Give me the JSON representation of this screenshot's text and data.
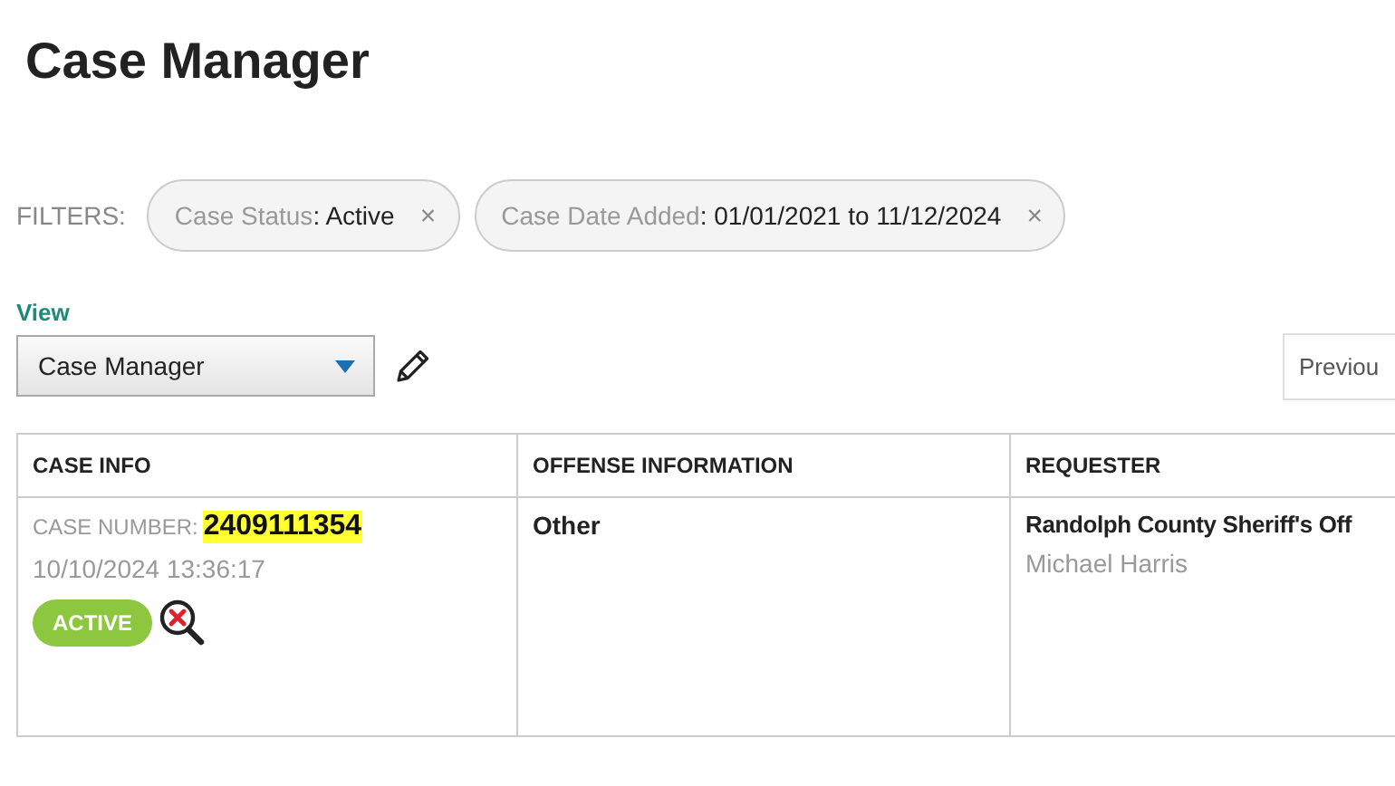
{
  "page_title": "Case Manager",
  "filters": {
    "label": "FILTERS:",
    "chips": [
      {
        "name": "Case Status",
        "value": ": Active",
        "remove": "×"
      },
      {
        "name": "Case Date Added",
        "value": ": 01/01/2021 to 11/12/2024",
        "remove": "×"
      }
    ]
  },
  "view": {
    "label": "View",
    "value": "Case Manager"
  },
  "pagination": {
    "previous": "Previou"
  },
  "table": {
    "columns": [
      "CASE INFO",
      "OFFENSE INFORMATION",
      "REQUESTER"
    ],
    "rows": [
      {
        "case_number_label": "CASE NUMBER:",
        "case_number": "2409111354",
        "date": "10/10/2024 13:36:17",
        "status": "ACTIVE",
        "offense": "Other",
        "agency": "Randolph County Sheriff's Off",
        "requester": "Michael Harris"
      }
    ]
  }
}
